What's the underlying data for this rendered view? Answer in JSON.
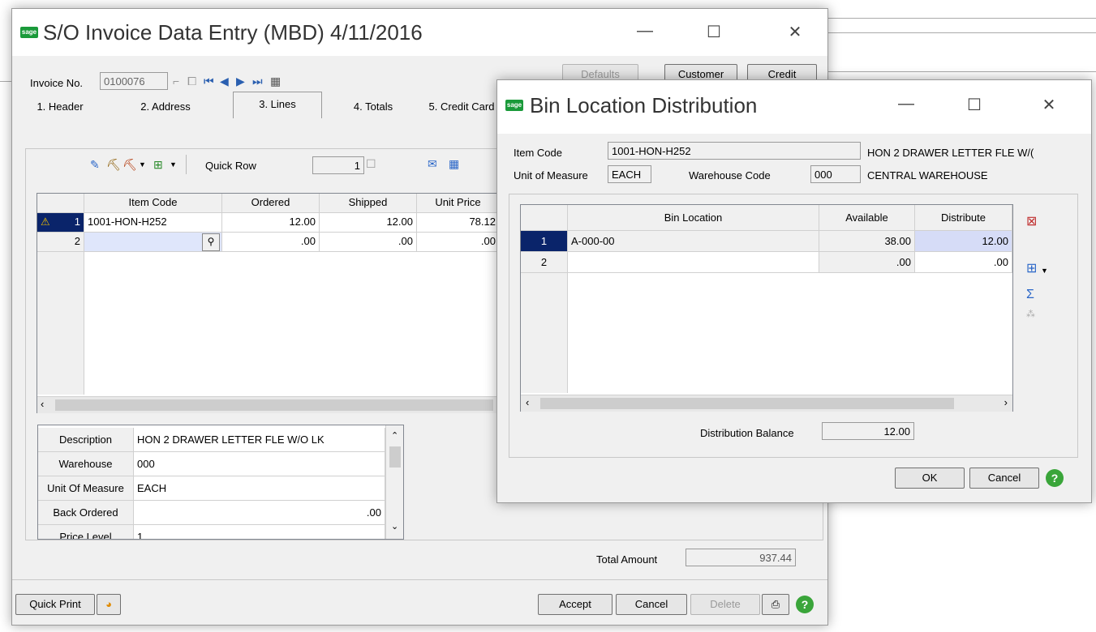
{
  "main": {
    "title": "S/O Invoice Data Entry (MBD) 4/11/2016",
    "invoice_label": "Invoice No.",
    "invoice_no": "0100076",
    "buttons_top": {
      "defaults": "Defaults",
      "customer": "Customer",
      "credit": "Credit"
    },
    "tabs": [
      {
        "label": "1. Header"
      },
      {
        "label": "2. Address"
      },
      {
        "label": "3. Lines"
      },
      {
        "label": "4. Totals"
      },
      {
        "label": "5. Credit Card"
      }
    ],
    "quick_row_label": "Quick Row",
    "quick_row_value": "1",
    "lines": {
      "columns": [
        "Item Code",
        "Ordered",
        "Shipped",
        "Unit Price"
      ],
      "rows": [
        {
          "num": "1",
          "item_code": "1001-HON-H252",
          "ordered": "12.00",
          "shipped": "12.00",
          "unit_price": "78.12"
        },
        {
          "num": "2",
          "item_code": "",
          "ordered": ".00",
          "shipped": ".00",
          "unit_price": ".00"
        }
      ]
    },
    "details": [
      {
        "label": "Description",
        "value": "HON 2 DRAWER LETTER FLE W/O LK"
      },
      {
        "label": "Warehouse",
        "value": "000"
      },
      {
        "label": "Unit Of Measure",
        "value": "EACH"
      },
      {
        "label": "Back Ordered",
        "value": ".00"
      },
      {
        "label": "Price Level",
        "value": "1"
      }
    ],
    "total_amount_label": "Total Amount",
    "total_amount": "937.44",
    "buttons_bottom": {
      "quick_print": "Quick Print",
      "accept": "Accept",
      "cancel": "Cancel",
      "delete": "Delete"
    }
  },
  "dialog": {
    "title": "Bin Location Distribution",
    "item_code_label": "Item Code",
    "item_code": "1001-HON-H252",
    "item_desc": "HON 2 DRAWER LETTER FLE W/(",
    "uom_label": "Unit of Measure",
    "uom": "EACH",
    "warehouse_label": "Warehouse Code",
    "warehouse": "000",
    "warehouse_name": "CENTRAL WAREHOUSE",
    "grid": {
      "columns": [
        "Bin Location",
        "Available",
        "Distribute"
      ],
      "rows": [
        {
          "num": "1",
          "bin": "A-000-00",
          "available": "38.00",
          "distribute": "12.00"
        },
        {
          "num": "2",
          "bin": "",
          "available": ".00",
          "distribute": ".00"
        }
      ]
    },
    "balance_label": "Distribution Balance",
    "balance": "12.00",
    "ok": "OK",
    "cancel": "Cancel"
  },
  "colors": {
    "sage_green": "#1a9a3a",
    "selection_blue": "#0a246a",
    "distribute_highlight": "#d6dcf7"
  }
}
